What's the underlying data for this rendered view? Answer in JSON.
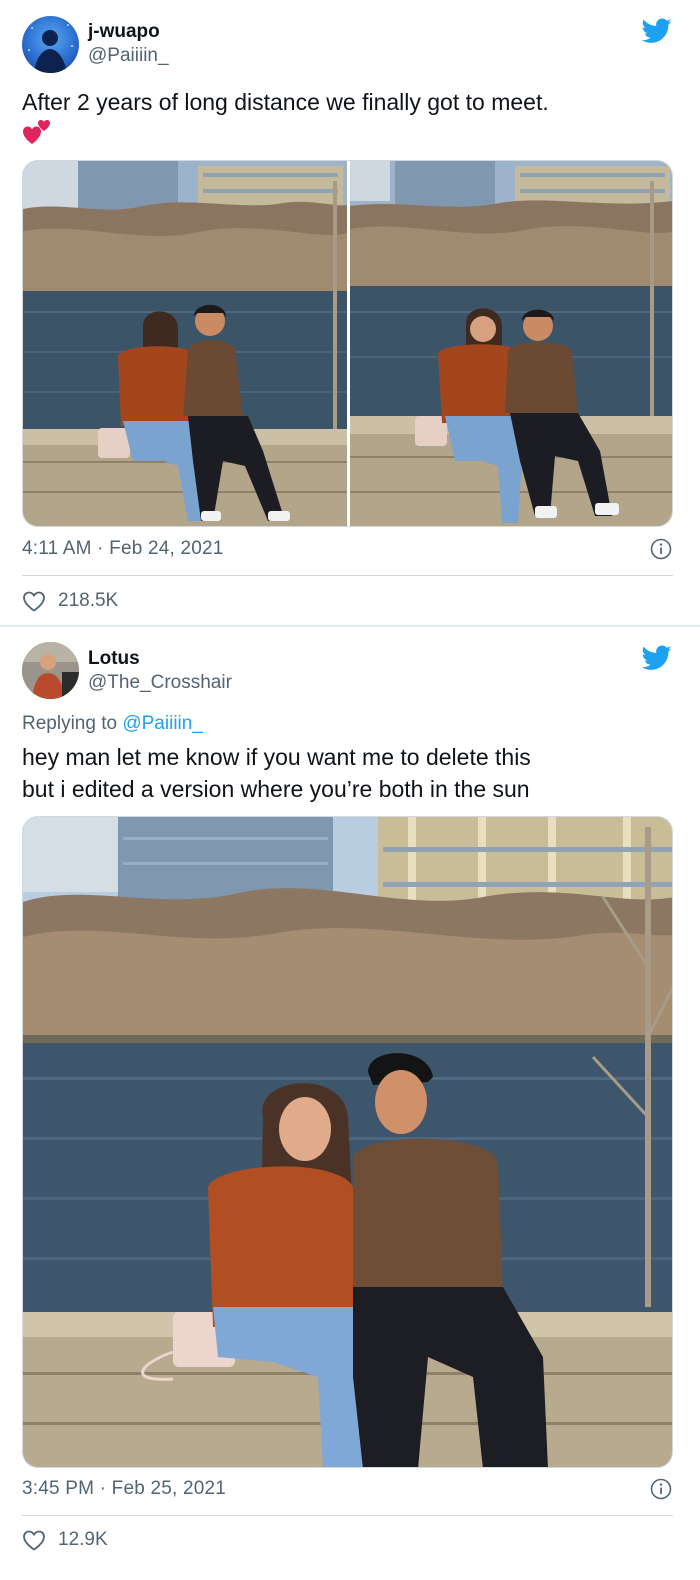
{
  "tweet1": {
    "author_name": "j-wuapo",
    "author_handle": "@Paiiiin_",
    "text": "After 2 years of long distance we finally got to meet.",
    "emoji": "❤️",
    "timestamp": "4:11 AM · Feb 24, 2021",
    "likes": "218.5K"
  },
  "tweet2": {
    "author_name": "Lotus",
    "author_handle": "@The_Crosshair",
    "reply_prefix": "Replying to",
    "reply_to": "@Paiiiin_",
    "text_line1": "hey man let me know if you want me to delete this",
    "text_line2": "but i edited a version where you’re both in the sun",
    "timestamp": "3:45 PM · Feb 25, 2021",
    "likes": "12.9K"
  },
  "colors": {
    "twitter_blue": "#1da1f2",
    "secondary_text": "#536471",
    "heart_red": "#e0245e"
  },
  "icons": [
    "twitter-bird-icon",
    "info-icon",
    "heart-icon",
    "hearts-emoji-icon"
  ]
}
